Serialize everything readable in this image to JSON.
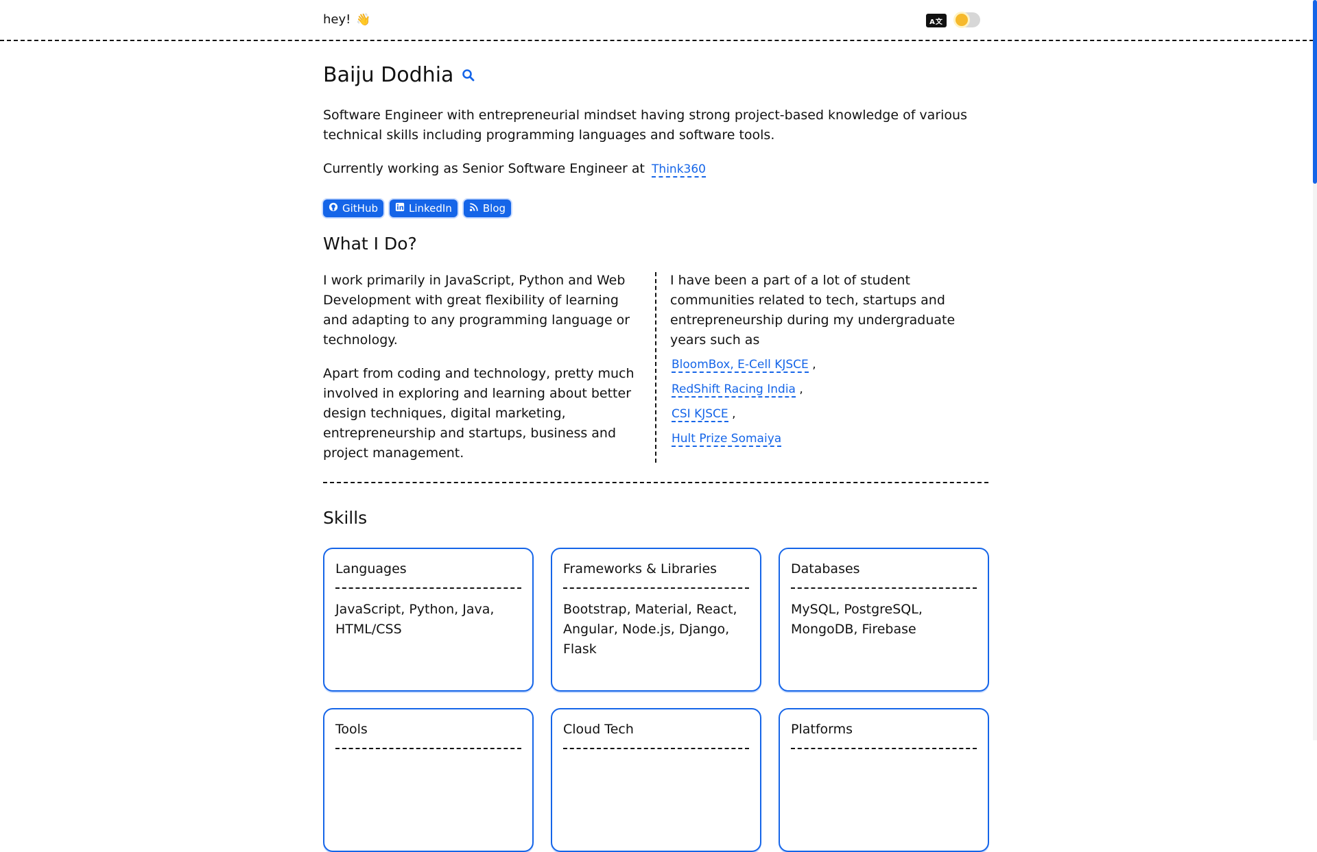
{
  "header": {
    "greeting": "hey!",
    "wave_emoji": "👋",
    "lang_icon": "translate-icon",
    "theme_toggle_icon": "sun-icon"
  },
  "profile": {
    "name": "Baiju Dodhia",
    "intro": "Software Engineer with entrepreneurial mindset having strong project-based knowledge of various technical skills including programming languages and software tools.",
    "current_prefix": "Currently working as Senior Software Engineer at",
    "company": "Think360",
    "links": [
      {
        "label": "GitHub",
        "icon": "github-icon"
      },
      {
        "label": "LinkedIn",
        "icon": "linkedin-icon"
      },
      {
        "label": "Blog",
        "icon": "rss-icon"
      }
    ]
  },
  "what_i_do": {
    "title": "What I Do?",
    "left_p1": "I work primarily in JavaScript, Python and Web Development with great flexibility of learning and adapting to any programming language or technology.",
    "left_p2": "Apart from coding and technology, pretty much involved in exploring and learning about better design techniques, digital marketing, entrepreneurship and startups, business and project management.",
    "right_p": "I have been a part of a lot of student communities related to tech, startups and entrepreneurship during my undergraduate years such as",
    "communities": [
      "BloomBox, E-Cell KJSCE",
      "RedShift Racing India",
      "CSI KJSCE",
      "Hult Prize Somaiya"
    ],
    "separator": ","
  },
  "skills": {
    "title": "Skills",
    "cards": [
      {
        "title": "Languages",
        "body": "JavaScript, Python, Java, HTML/CSS"
      },
      {
        "title": "Frameworks & Libraries",
        "body": "Bootstrap, Material, React, Angular, Node.js, Django, Flask"
      },
      {
        "title": "Databases",
        "body": "MySQL, PostgreSQL, MongoDB, Firebase"
      },
      {
        "title": "Tools",
        "body": ""
      },
      {
        "title": "Cloud Tech",
        "body": ""
      },
      {
        "title": "Platforms",
        "body": ""
      }
    ]
  },
  "colors": {
    "accent": "#1565e8",
    "text": "#111111",
    "toggle_sun": "#f6b92b"
  }
}
